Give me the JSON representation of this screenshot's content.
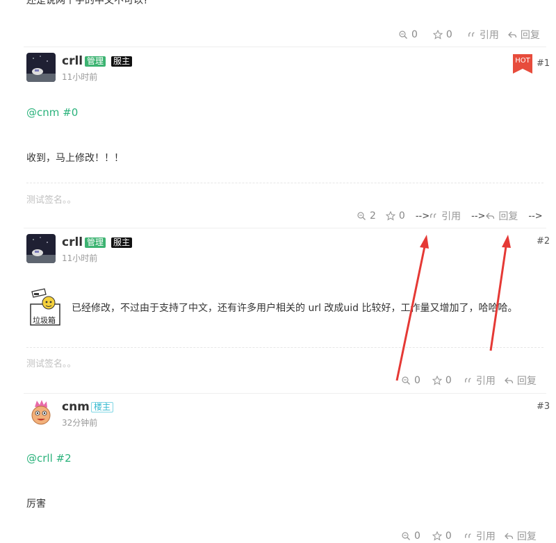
{
  "top_text": "还是说网个字的中文不可以?",
  "posts": [
    {
      "actions": {
        "views": "0",
        "stars": "0",
        "quote": "引用",
        "reply": "回复"
      }
    },
    {
      "username": "crll",
      "badges": [
        "管理",
        "服主"
      ],
      "time": "11小时前",
      "hot": "HOT",
      "floor": "#1",
      "mention": "@cnm #0",
      "content": "收到，马上修改！！！",
      "signature": "测试签名。。",
      "actions": {
        "views": "2",
        "stars": "0",
        "quote": "引用",
        "reply": "回复"
      },
      "arrows": [
        "-->",
        "-->",
        "-->"
      ]
    },
    {
      "username": "crll",
      "badges": [
        "管理",
        "服主"
      ],
      "time": "11小时前",
      "floor": "#2",
      "sticker_text": "垃圾箱",
      "content": "已经修改，不过由于支持了中文，还有许多用户相关的 url 改成uid 比较好，工作量又增加了，哈哈哈。",
      "signature": "测试签名。。",
      "actions": {
        "views": "0",
        "stars": "0",
        "quote": "引用",
        "reply": "回复"
      }
    },
    {
      "username": "cnm",
      "badges": [
        "楼主"
      ],
      "time": "32分钟前",
      "floor": "#3",
      "mention": "@crll #2",
      "content": "厉害",
      "actions": {
        "views": "0",
        "stars": "0",
        "quote": "引用",
        "reply": "回复"
      }
    }
  ],
  "colors": {
    "mention": "#2ab27b",
    "admin_badge": "#3cb371",
    "hot": "#e74c3c",
    "annotation_arrow": "#e53935"
  }
}
